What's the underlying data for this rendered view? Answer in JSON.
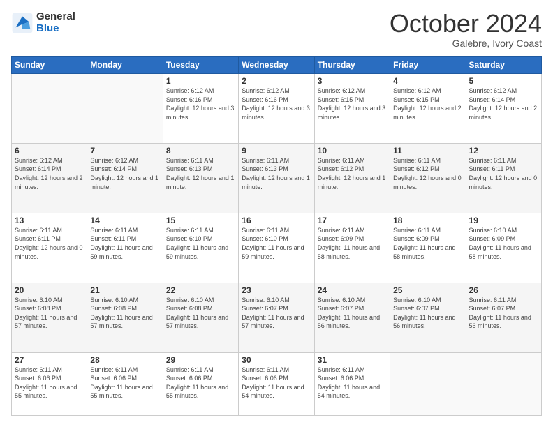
{
  "header": {
    "logo": {
      "general": "General",
      "blue": "Blue"
    },
    "title": "October 2024",
    "subtitle": "Galebre, Ivory Coast"
  },
  "weekdays": [
    "Sunday",
    "Monday",
    "Tuesday",
    "Wednesday",
    "Thursday",
    "Friday",
    "Saturday"
  ],
  "weeks": [
    [
      {
        "day": "",
        "info": ""
      },
      {
        "day": "",
        "info": ""
      },
      {
        "day": "1",
        "info": "Sunrise: 6:12 AM\nSunset: 6:16 PM\nDaylight: 12 hours and 3 minutes."
      },
      {
        "day": "2",
        "info": "Sunrise: 6:12 AM\nSunset: 6:16 PM\nDaylight: 12 hours and 3 minutes."
      },
      {
        "day": "3",
        "info": "Sunrise: 6:12 AM\nSunset: 6:15 PM\nDaylight: 12 hours and 3 minutes."
      },
      {
        "day": "4",
        "info": "Sunrise: 6:12 AM\nSunset: 6:15 PM\nDaylight: 12 hours and 2 minutes."
      },
      {
        "day": "5",
        "info": "Sunrise: 6:12 AM\nSunset: 6:14 PM\nDaylight: 12 hours and 2 minutes."
      }
    ],
    [
      {
        "day": "6",
        "info": "Sunrise: 6:12 AM\nSunset: 6:14 PM\nDaylight: 12 hours and 2 minutes."
      },
      {
        "day": "7",
        "info": "Sunrise: 6:12 AM\nSunset: 6:14 PM\nDaylight: 12 hours and 1 minute."
      },
      {
        "day": "8",
        "info": "Sunrise: 6:11 AM\nSunset: 6:13 PM\nDaylight: 12 hours and 1 minute."
      },
      {
        "day": "9",
        "info": "Sunrise: 6:11 AM\nSunset: 6:13 PM\nDaylight: 12 hours and 1 minute."
      },
      {
        "day": "10",
        "info": "Sunrise: 6:11 AM\nSunset: 6:12 PM\nDaylight: 12 hours and 1 minute."
      },
      {
        "day": "11",
        "info": "Sunrise: 6:11 AM\nSunset: 6:12 PM\nDaylight: 12 hours and 0 minutes."
      },
      {
        "day": "12",
        "info": "Sunrise: 6:11 AM\nSunset: 6:11 PM\nDaylight: 12 hours and 0 minutes."
      }
    ],
    [
      {
        "day": "13",
        "info": "Sunrise: 6:11 AM\nSunset: 6:11 PM\nDaylight: 12 hours and 0 minutes."
      },
      {
        "day": "14",
        "info": "Sunrise: 6:11 AM\nSunset: 6:11 PM\nDaylight: 11 hours and 59 minutes."
      },
      {
        "day": "15",
        "info": "Sunrise: 6:11 AM\nSunset: 6:10 PM\nDaylight: 11 hours and 59 minutes."
      },
      {
        "day": "16",
        "info": "Sunrise: 6:11 AM\nSunset: 6:10 PM\nDaylight: 11 hours and 59 minutes."
      },
      {
        "day": "17",
        "info": "Sunrise: 6:11 AM\nSunset: 6:09 PM\nDaylight: 11 hours and 58 minutes."
      },
      {
        "day": "18",
        "info": "Sunrise: 6:11 AM\nSunset: 6:09 PM\nDaylight: 11 hours and 58 minutes."
      },
      {
        "day": "19",
        "info": "Sunrise: 6:10 AM\nSunset: 6:09 PM\nDaylight: 11 hours and 58 minutes."
      }
    ],
    [
      {
        "day": "20",
        "info": "Sunrise: 6:10 AM\nSunset: 6:08 PM\nDaylight: 11 hours and 57 minutes."
      },
      {
        "day": "21",
        "info": "Sunrise: 6:10 AM\nSunset: 6:08 PM\nDaylight: 11 hours and 57 minutes."
      },
      {
        "day": "22",
        "info": "Sunrise: 6:10 AM\nSunset: 6:08 PM\nDaylight: 11 hours and 57 minutes."
      },
      {
        "day": "23",
        "info": "Sunrise: 6:10 AM\nSunset: 6:07 PM\nDaylight: 11 hours and 57 minutes."
      },
      {
        "day": "24",
        "info": "Sunrise: 6:10 AM\nSunset: 6:07 PM\nDaylight: 11 hours and 56 minutes."
      },
      {
        "day": "25",
        "info": "Sunrise: 6:10 AM\nSunset: 6:07 PM\nDaylight: 11 hours and 56 minutes."
      },
      {
        "day": "26",
        "info": "Sunrise: 6:11 AM\nSunset: 6:07 PM\nDaylight: 11 hours and 56 minutes."
      }
    ],
    [
      {
        "day": "27",
        "info": "Sunrise: 6:11 AM\nSunset: 6:06 PM\nDaylight: 11 hours and 55 minutes."
      },
      {
        "day": "28",
        "info": "Sunrise: 6:11 AM\nSunset: 6:06 PM\nDaylight: 11 hours and 55 minutes."
      },
      {
        "day": "29",
        "info": "Sunrise: 6:11 AM\nSunset: 6:06 PM\nDaylight: 11 hours and 55 minutes."
      },
      {
        "day": "30",
        "info": "Sunrise: 6:11 AM\nSunset: 6:06 PM\nDaylight: 11 hours and 54 minutes."
      },
      {
        "day": "31",
        "info": "Sunrise: 6:11 AM\nSunset: 6:06 PM\nDaylight: 11 hours and 54 minutes."
      },
      {
        "day": "",
        "info": ""
      },
      {
        "day": "",
        "info": ""
      }
    ]
  ]
}
